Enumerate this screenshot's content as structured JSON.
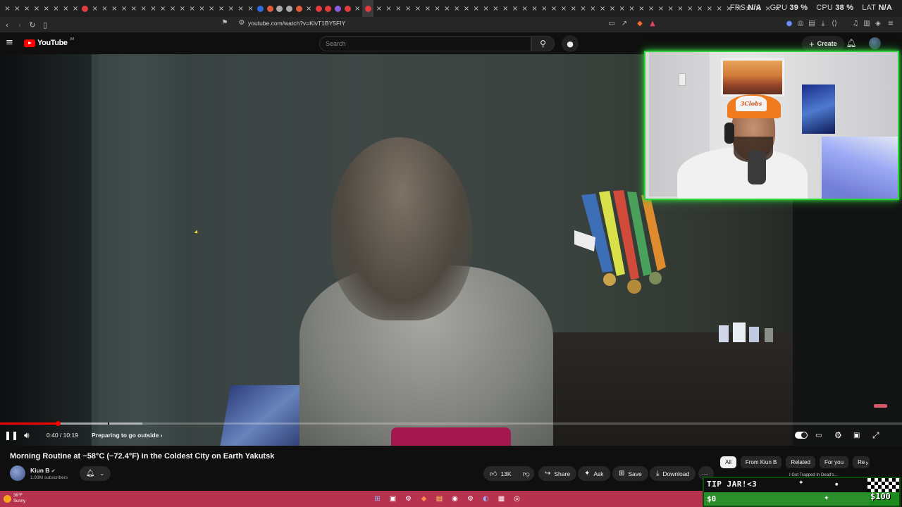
{
  "browser": {
    "url": "youtube.com/watch?v=KlvT1BY5FIY",
    "perf": {
      "fps_label": "FPS",
      "fps": "N/A",
      "gpu_label": "GPU",
      "gpu": "39 %",
      "cpu_label": "CPU",
      "cpu": "38 %",
      "lat_label": "LAT",
      "lat": "N/A"
    }
  },
  "youtube": {
    "logo_text": "YouTube",
    "logo_country": "JM",
    "search_placeholder": "Search",
    "create_label": "Create"
  },
  "player": {
    "time": "0:40 / 10:19",
    "chapter": "Preparing to go outside",
    "chapter_chevron": "›",
    "progress": 0.0646,
    "buffered": 0.158
  },
  "video": {
    "title": "Morning Routine at −58°C (−72.4°F) in the Coldest City on Earth Yakutsk",
    "channel": "Kiun B",
    "verified": "✔",
    "subscribers": "1.93M subscribers",
    "likes": "13K",
    "share_label": "Share",
    "ask_label": "Ask",
    "save_label": "Save",
    "download_label": "Download",
    "more_label": "···"
  },
  "recommendations": {
    "chips": [
      "All",
      "From Kiun B",
      "Related",
      "For you",
      "Re"
    ],
    "snippet": "I Got Trapped In Dead's..."
  },
  "webcam": {
    "cap_text": "3Clobs"
  },
  "tipjar": {
    "label": "TIP JAR!<3",
    "amount": "$0",
    "goal": "$100",
    "progress": 0
  },
  "taskbar": {
    "temp": "38°F",
    "condition": "Sunny"
  },
  "colors": {
    "youtube_red": "#ff0000",
    "webcam_border": "#2fd23a",
    "taskbar": "#b6324e",
    "tipjar_green": "#1d8a1d"
  }
}
